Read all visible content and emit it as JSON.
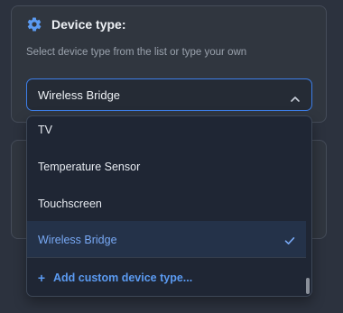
{
  "field": {
    "title": "Device type:",
    "hint": "Select device type from the list or type your own",
    "selected_value": "Wireless Bridge"
  },
  "dropdown": {
    "options": [
      {
        "label": "TV",
        "selected": false
      },
      {
        "label": "Temperature Sensor",
        "selected": false
      },
      {
        "label": "Touchscreen",
        "selected": false
      },
      {
        "label": "Wireless Bridge",
        "selected": true
      }
    ],
    "add_custom_label": "Add custom device type...",
    "add_custom_icon": "plus-icon"
  },
  "icons": {
    "title_icon": "gear-icon",
    "select_chevron": "chevron-up-icon",
    "selected_mark": "check-icon"
  },
  "colors": {
    "accent": "#3d7ee8",
    "selected_text": "#78a9f5",
    "link": "#5b9bf2",
    "panel_bg": "#1f2634"
  }
}
